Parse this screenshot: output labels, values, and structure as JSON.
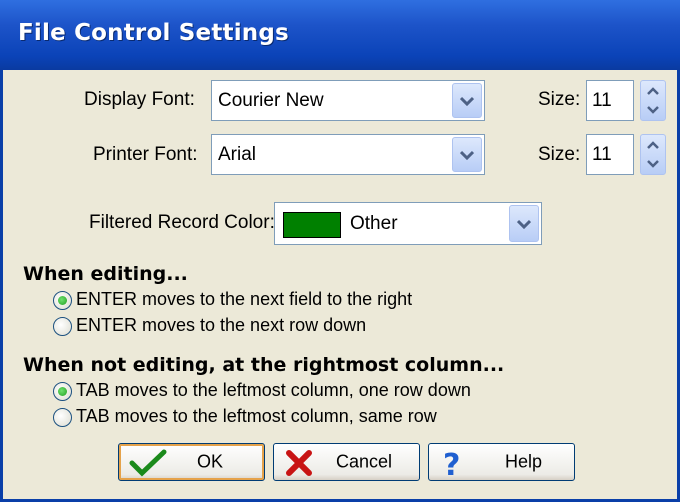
{
  "window": {
    "title": "File Control Settings"
  },
  "fonts": {
    "display": {
      "label": "Display Font:",
      "value": "Courier New",
      "size_label": "Size:",
      "size": "11"
    },
    "printer": {
      "label": "Printer Font:",
      "value": "Arial",
      "size_label": "Size:",
      "size": "11"
    }
  },
  "filtered": {
    "label": "Filtered Record Color:",
    "value": "Other",
    "swatch_color": "#008000"
  },
  "editing": {
    "heading": "When editing...",
    "options": [
      {
        "label": "ENTER moves to the next field to the right",
        "selected": true
      },
      {
        "label": "ENTER moves to the next row down",
        "selected": false
      }
    ]
  },
  "not_editing": {
    "heading": "When not editing, at the rightmost column...",
    "options": [
      {
        "label": "TAB moves to the leftmost column, one row down",
        "selected": true
      },
      {
        "label": "TAB moves to the leftmost column, same row",
        "selected": false
      }
    ]
  },
  "buttons": {
    "ok": "OK",
    "cancel": "Cancel",
    "help": "Help"
  },
  "icons": {
    "ok": "checkmark-icon",
    "cancel": "x-icon",
    "help": "question-icon"
  },
  "colors": {
    "title_bar": "#0b43b8",
    "dialog_bg": "#ece9d8"
  }
}
